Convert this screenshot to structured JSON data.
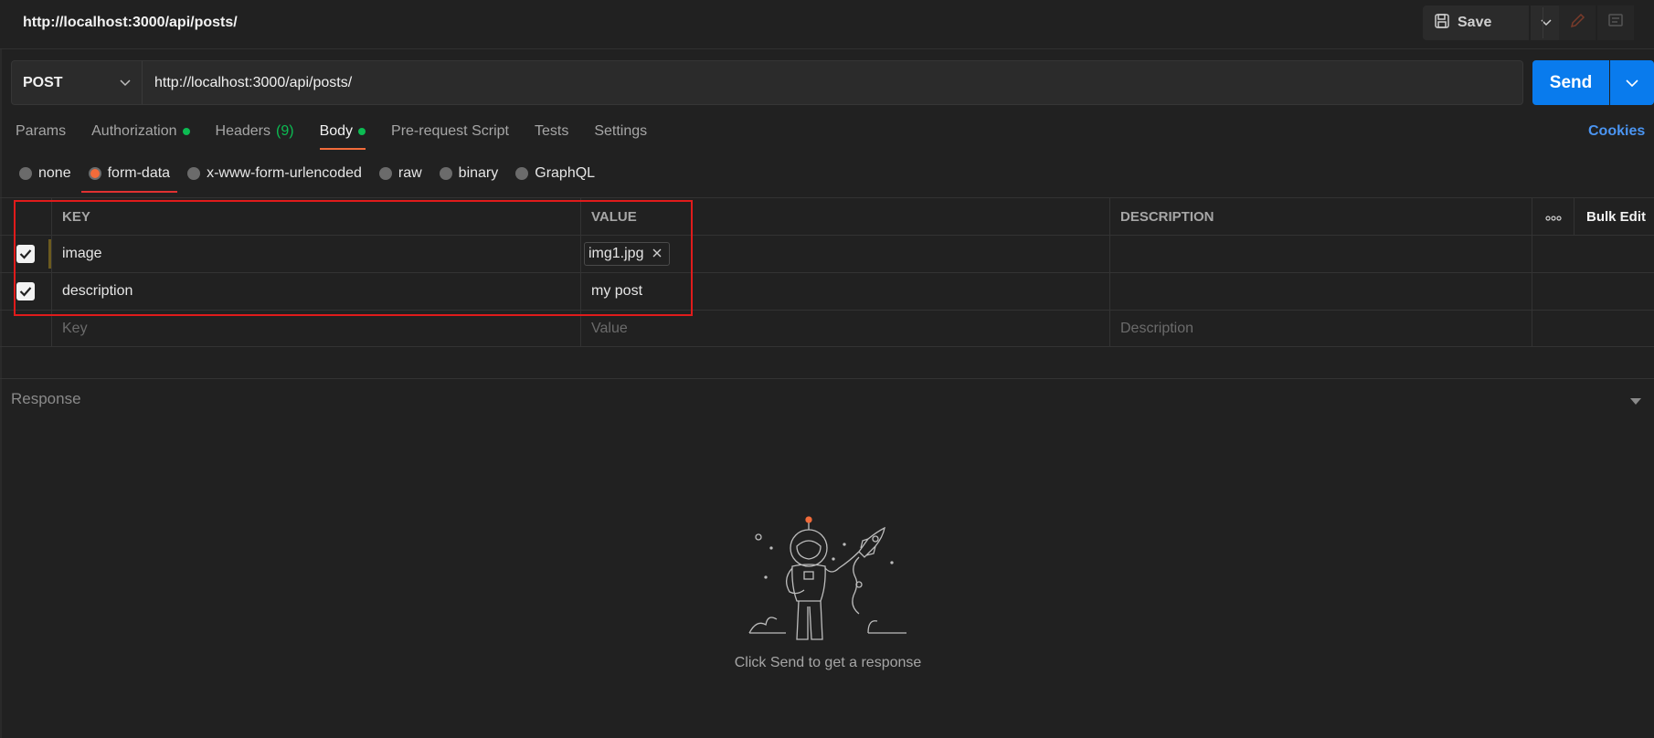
{
  "request": {
    "title": "http://localhost:3000/api/posts/",
    "method": "POST",
    "url": "http://localhost:3000/api/posts/"
  },
  "toolbar": {
    "save_label": "Save",
    "send_label": "Send"
  },
  "tabs": [
    {
      "label": "Params",
      "active": false
    },
    {
      "label": "Authorization",
      "dot": true
    },
    {
      "label": "Headers",
      "count": "(9)"
    },
    {
      "label": "Body",
      "dot": true,
      "active": true
    },
    {
      "label": "Pre-request Script"
    },
    {
      "label": "Tests"
    },
    {
      "label": "Settings"
    }
  ],
  "cookies_label": "Cookies",
  "body_types": [
    {
      "label": "none"
    },
    {
      "label": "form-data",
      "selected": true
    },
    {
      "label": "x-www-form-urlencoded"
    },
    {
      "label": "raw"
    },
    {
      "label": "binary"
    },
    {
      "label": "GraphQL"
    }
  ],
  "table": {
    "headers": {
      "key": "KEY",
      "value": "VALUE",
      "description": "DESCRIPTION",
      "bulk_edit": "Bulk Edit"
    },
    "rows": [
      {
        "checked": true,
        "key": "image",
        "value": "img1.jpg",
        "value_type": "file",
        "description": ""
      },
      {
        "checked": true,
        "key": "description",
        "value": "my post",
        "value_type": "text",
        "description": ""
      }
    ],
    "placeholders": {
      "key": "Key",
      "value": "Value",
      "description": "Description"
    }
  },
  "response": {
    "label": "Response",
    "empty_message": "Click Send to get a response"
  },
  "colors": {
    "accent": "#f26b3a",
    "send": "#097bed",
    "status_dot": "#0cbb52",
    "link": "#4b95f2",
    "highlight": "#e01b1b"
  }
}
